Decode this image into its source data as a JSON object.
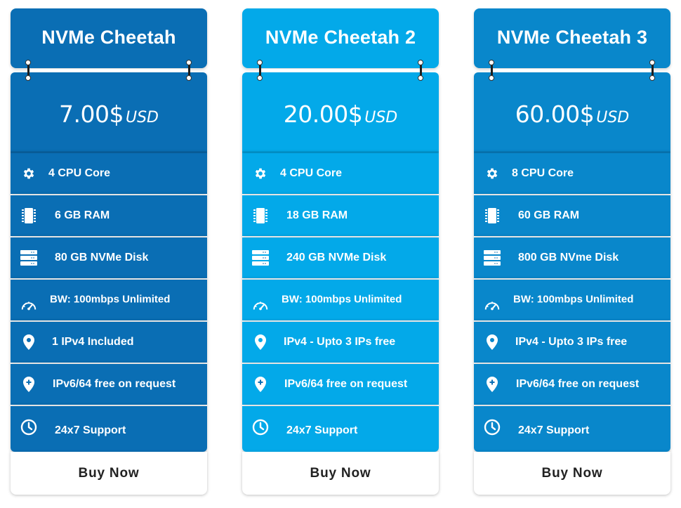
{
  "colors": {
    "plan1": "#0a6eb4",
    "plan2": "#03a9e9",
    "plan3": "#0987cb"
  },
  "plans": [
    {
      "name": "NVMe Cheetah",
      "price": "7.00$",
      "currency": "USD",
      "features": [
        {
          "icon": "gear-icon",
          "label": "4 CPU Core"
        },
        {
          "icon": "memory-chip-icon",
          "label": "6 GB RAM"
        },
        {
          "icon": "server-icon",
          "label": "80 GB NVMe Disk"
        },
        {
          "icon": "speedometer-icon",
          "label": "BW: 100mbps Unlimited"
        },
        {
          "icon": "location-pin-icon",
          "label": "1 IPv4 Included"
        },
        {
          "icon": "location-plus-icon",
          "label": "IPv6/64 free on request"
        },
        {
          "icon": "clock-icon",
          "label": "24x7 Support"
        }
      ],
      "button": "Buy Now"
    },
    {
      "name": "NVMe Cheetah 2",
      "price": "20.00$",
      "currency": "USD",
      "features": [
        {
          "icon": "gear-icon",
          "label": "4 CPU Core"
        },
        {
          "icon": "memory-chip-icon",
          "label": "18 GB RAM"
        },
        {
          "icon": "server-icon",
          "label": "240 GB NVMe Disk"
        },
        {
          "icon": "speedometer-icon",
          "label": "BW: 100mbps Unlimited"
        },
        {
          "icon": "location-pin-icon",
          "label": "IPv4 - Upto 3 IPs free"
        },
        {
          "icon": "location-plus-icon",
          "label": "IPv6/64 free on request"
        },
        {
          "icon": "clock-icon",
          "label": "24x7 Support"
        }
      ],
      "button": "Buy Now"
    },
    {
      "name": "NVMe Cheetah 3",
      "price": "60.00$",
      "currency": "USD",
      "features": [
        {
          "icon": "gear-icon",
          "label": "8 CPU Core"
        },
        {
          "icon": "memory-chip-icon",
          "label": "60 GB RAM"
        },
        {
          "icon": "server-icon",
          "label": "800 GB NVme Disk"
        },
        {
          "icon": "speedometer-icon",
          "label": "BW: 100mbps Unlimited"
        },
        {
          "icon": "location-pin-icon",
          "label": "IPv4 - Upto 3 IPs free"
        },
        {
          "icon": "location-plus-icon",
          "label": "IPv6/64 free on request"
        },
        {
          "icon": "clock-icon",
          "label": "24x7 Support"
        }
      ],
      "button": "Buy Now"
    }
  ]
}
